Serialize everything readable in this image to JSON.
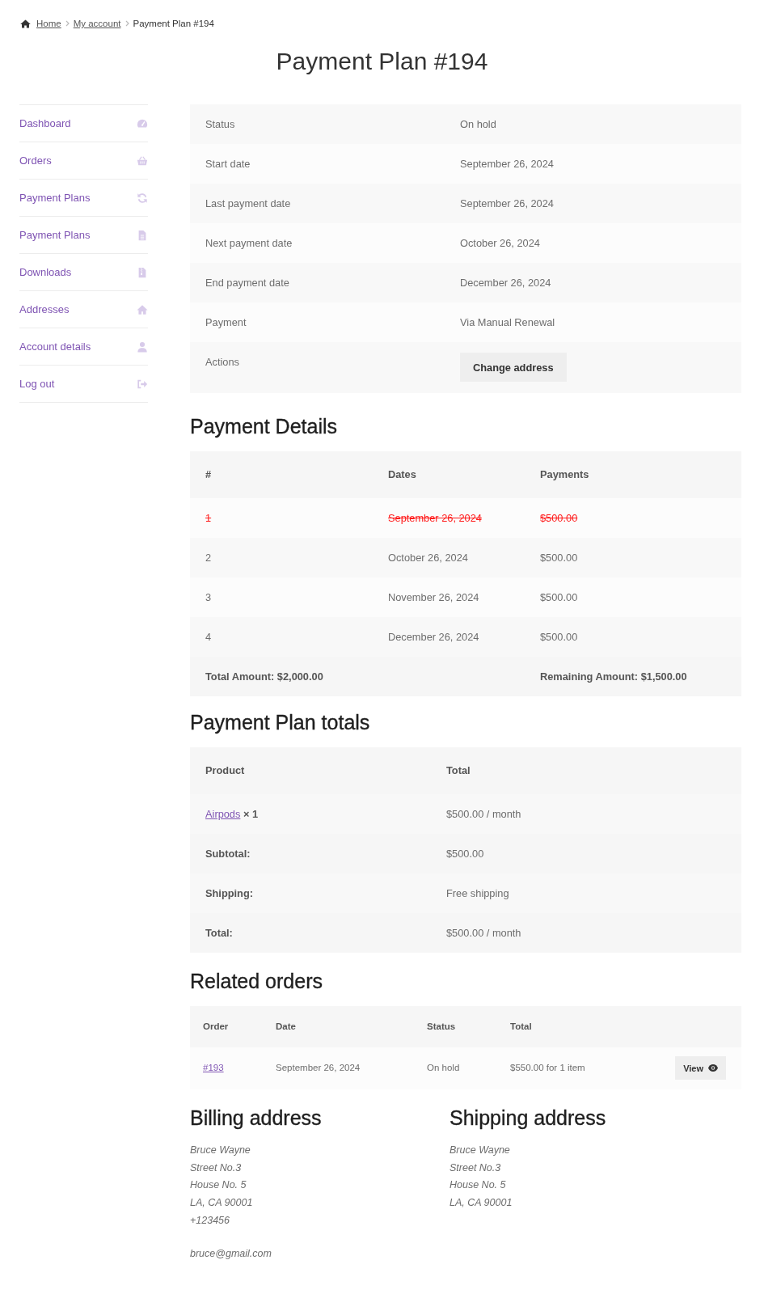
{
  "breadcrumb": {
    "items": [
      {
        "label": "Home",
        "link": true
      },
      {
        "label": "My account",
        "link": true
      },
      {
        "label": "Payment Plan #194",
        "link": false
      }
    ]
  },
  "page_title": "Payment Plan #194",
  "sidebar": {
    "items": [
      {
        "label": "Dashboard",
        "kind": "dashboard",
        "selected": false
      },
      {
        "label": "Orders",
        "kind": "orders",
        "selected": false
      },
      {
        "label": "Payment Plans",
        "kind": "plans",
        "selected": false
      },
      {
        "label": "Payment Plans",
        "kind": "invoices",
        "selected": false
      },
      {
        "label": "Downloads",
        "kind": "downloads",
        "selected": false
      },
      {
        "label": "Addresses",
        "kind": "addresses",
        "selected": false
      },
      {
        "label": "Account details",
        "kind": "account",
        "selected": false
      },
      {
        "label": "Log out",
        "kind": "logout",
        "selected": false
      }
    ]
  },
  "plan_details": {
    "rows": [
      {
        "kind": "text",
        "label": "Status",
        "value": "On hold"
      },
      {
        "kind": "text",
        "label": "Start date",
        "value": "September 26, 2024"
      },
      {
        "kind": "text",
        "label": "Last payment date",
        "value": "September 26, 2024"
      },
      {
        "kind": "text",
        "label": "Next payment date",
        "value": "October 26, 2024"
      },
      {
        "kind": "text",
        "label": "End payment date",
        "value": "December 26, 2024"
      },
      {
        "kind": "text",
        "label": "Payment",
        "value": "Via Manual Renewal"
      },
      {
        "kind": "actions",
        "label": "Actions",
        "buttons": [
          "Change address"
        ]
      }
    ]
  },
  "payment_details": {
    "heading": "Payment Details",
    "columns": [
      "#",
      "Dates",
      "Payments"
    ],
    "rows": [
      {
        "cells": [
          "1",
          "September 26, 2024",
          "$500.00"
        ],
        "paid": true
      },
      {
        "cells": [
          "2",
          "October 26, 2024",
          "$500.00"
        ],
        "paid": false
      },
      {
        "cells": [
          "3",
          "November 26, 2024",
          "$500.00"
        ],
        "paid": false
      },
      {
        "cells": [
          "4",
          "December 26, 2024",
          "$500.00"
        ],
        "paid": false
      }
    ],
    "footer": {
      "total": "Total Amount: $2,000.00",
      "remaining": "Remaining Amount: $1,500.00"
    }
  },
  "plan_totals": {
    "heading": "Payment Plan totals",
    "columns": [
      "Product",
      "Total"
    ],
    "items": [
      {
        "product": "Airpods",
        "quantity": "× 1",
        "total": "$500.00 / month"
      }
    ],
    "summary": [
      {
        "label": "Subtotal:",
        "value": "$500.00"
      },
      {
        "label": "Shipping:",
        "value": "Free shipping"
      },
      {
        "label": "Total:",
        "value": "$500.00 / month"
      }
    ]
  },
  "related_orders": {
    "heading": "Related orders",
    "columns": [
      "Order",
      "Date",
      "Status",
      "Total"
    ],
    "rows": [
      {
        "order": "#193",
        "date": "September 26, 2024",
        "status": "On hold",
        "total": "$550.00 for 1 item",
        "action": "View"
      }
    ]
  },
  "billing_address": {
    "heading": "Billing address",
    "lines": [
      "Bruce Wayne",
      "Street No.3",
      "House No. 5",
      "LA, CA 90001"
    ],
    "phone": "+123456",
    "email": "bruce@gmail.com"
  },
  "shipping_address": {
    "heading": "Shipping address",
    "lines": [
      "Bruce Wayne",
      "Street No.3",
      "House No. 5",
      "LA, CA 90001"
    ]
  }
}
